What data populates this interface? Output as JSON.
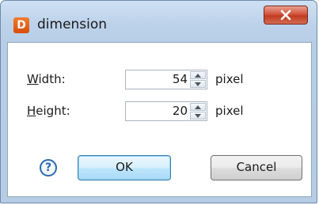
{
  "window": {
    "title": "dimension",
    "app_icon_glyph": "D",
    "close_icon": "close-x-icon"
  },
  "fields": {
    "width": {
      "label_accel": "W",
      "label_rest": "idth:",
      "value": "54",
      "unit": "pixel"
    },
    "height": {
      "label_accel": "H",
      "label_rest": "eight:",
      "value": "20",
      "unit": "pixel"
    }
  },
  "buttons": {
    "help_glyph": "?",
    "ok_label": "OK",
    "cancel_label": "Cancel"
  },
  "colors": {
    "accent": "#3c7fb1",
    "close": "#c03b22",
    "app_icon": "#e8601a"
  }
}
